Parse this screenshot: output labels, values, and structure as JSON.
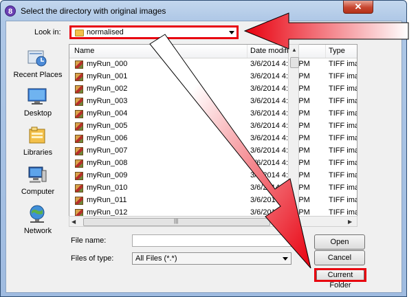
{
  "window": {
    "title": "Select the directory with original images",
    "close_glyph": "✕",
    "app_glyph": "8"
  },
  "lookin": {
    "label": "Look in:",
    "value": "normalised"
  },
  "places": [
    {
      "label": "Recent Places",
      "icon": "recent-places-icon"
    },
    {
      "label": "Desktop",
      "icon": "desktop-icon"
    },
    {
      "label": "Libraries",
      "icon": "libraries-icon"
    },
    {
      "label": "Computer",
      "icon": "computer-icon"
    },
    {
      "label": "Network",
      "icon": "network-icon"
    }
  ],
  "table": {
    "columns": [
      "Name",
      "Date modified",
      "Type"
    ],
    "rows": [
      {
        "name": "myRun_000",
        "date": "3/6/2014 4:57 PM",
        "type": "TIFF ima"
      },
      {
        "name": "myRun_001",
        "date": "3/6/2014 4:57 PM",
        "type": "TIFF ima"
      },
      {
        "name": "myRun_002",
        "date": "3/6/2014 4:57 PM",
        "type": "TIFF ima"
      },
      {
        "name": "myRun_003",
        "date": "3/6/2014 4:57 PM",
        "type": "TIFF ima"
      },
      {
        "name": "myRun_004",
        "date": "3/6/2014 4:57 PM",
        "type": "TIFF ima"
      },
      {
        "name": "myRun_005",
        "date": "3/6/2014 4:57 PM",
        "type": "TIFF ima"
      },
      {
        "name": "myRun_006",
        "date": "3/6/2014 4:57 PM",
        "type": "TIFF ima"
      },
      {
        "name": "myRun_007",
        "date": "3/6/2014 4:57 PM",
        "type": "TIFF ima"
      },
      {
        "name": "myRun_008",
        "date": "3/6/2014 4:57 PM",
        "type": "TIFF ima"
      },
      {
        "name": "myRun_009",
        "date": "3/6/2014 4:57 PM",
        "type": "TIFF ima"
      },
      {
        "name": "myRun_010",
        "date": "3/6/2014 4:57 PM",
        "type": "TIFF ima"
      },
      {
        "name": "myRun_011",
        "date": "3/6/2014 4:57 PM",
        "type": "TIFF ima"
      },
      {
        "name": "myRun_012",
        "date": "3/6/2014 4:57 PM",
        "type": "TIFF ima"
      }
    ]
  },
  "form": {
    "filename_label": "File name:",
    "filename_value": "",
    "filetype_label": "Files of type:",
    "filetype_value": "All Files (*.*)"
  },
  "buttons": {
    "open": "Open",
    "cancel": "Cancel",
    "current_folder": "Current Folder"
  },
  "colors": {
    "annotation": "#e8000e"
  }
}
